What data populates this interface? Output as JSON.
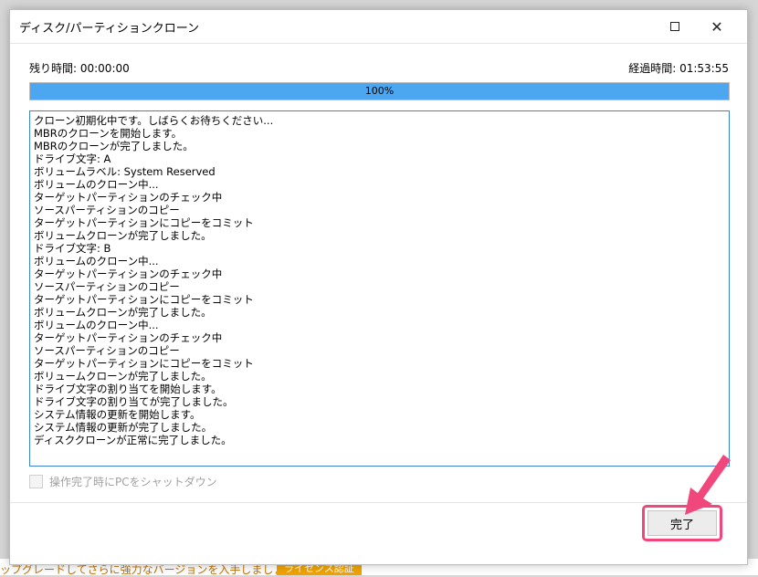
{
  "window": {
    "title": "ディスク/パーティションクローン",
    "close_glyph": "✕"
  },
  "status": {
    "remaining_label": "残り時間: 00:00:00",
    "elapsed_label": "経過時間: 01:53:55"
  },
  "progress": {
    "value": 1.0,
    "text": "100%",
    "color": "#4da6f0"
  },
  "log": {
    "lines": [
      "クローン初期化中です。しばらくお待ちください...",
      "MBRのクローンを開始します。",
      "MBRのクローンが完了しました。",
      "ドライブ文字: A",
      "ボリュームラベル: System Reserved",
      "ボリュームのクローン中...",
      "ターゲットパーティションのチェック中",
      "ソースパーティションのコピー",
      "ターゲットパーティションにコピーをコミット",
      "ボリュームクローンが完了しました。",
      "ドライブ文字: B",
      "ボリュームのクローン中...",
      "ターゲットパーティションのチェック中",
      "ソースパーティションのコピー",
      "ターゲットパーティションにコピーをコミット",
      "ボリュームクローンが完了しました。",
      "ボリュームのクローン中...",
      "ターゲットパーティションのチェック中",
      "ソースパーティションのコピー",
      "ターゲットパーティションにコピーをコミット",
      "ボリュームクローンが完了しました。",
      "ドライブ文字の割り当てを開始します。",
      "ドライブ文字の割り当てが完了しました。",
      "システム情報の更新を開始します。",
      "システム情報の更新が完了しました。",
      "ディスククローンが正常に完了しました。"
    ]
  },
  "shutdown_option": {
    "label": "操作完了時にPCをシャットダウン",
    "checked": false,
    "disabled": true
  },
  "buttons": {
    "done_label": "完了"
  },
  "background": {
    "upgrade_text": "ップグレードしてさらに強力なバージョンを入手しましょう。",
    "license_button": "ライセンス認証"
  },
  "colors": {
    "highlight": "#f0487c",
    "accent_border": "#3b83d0"
  },
  "icons": {
    "maximize": "maximize-icon",
    "close": "close-icon",
    "annotation": "pointer-arrow-icon"
  }
}
